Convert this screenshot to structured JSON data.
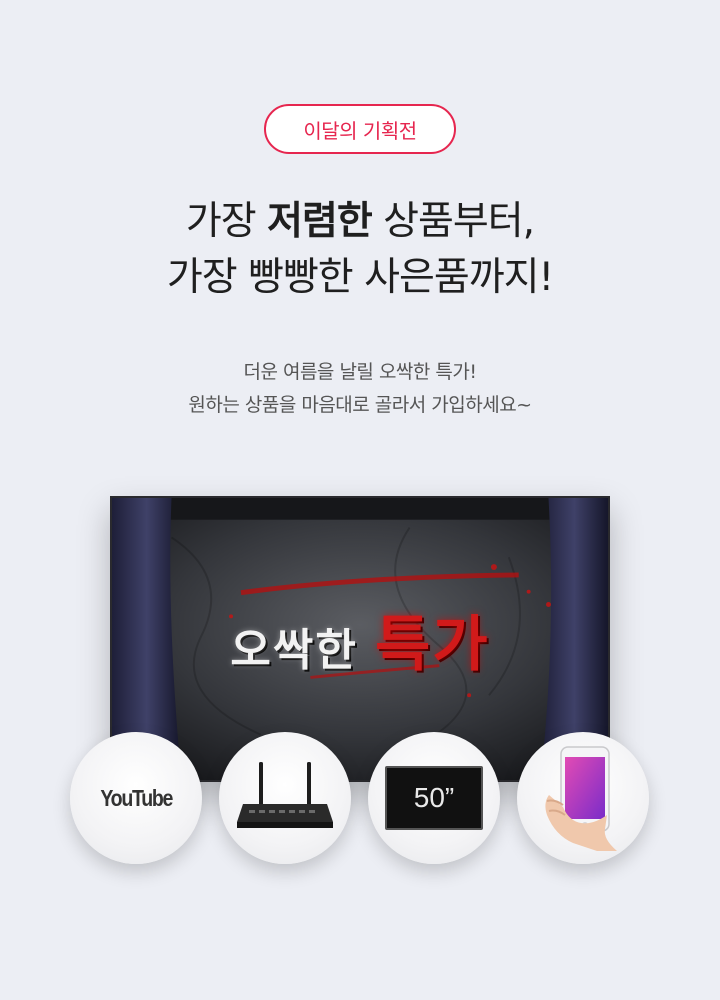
{
  "badge": {
    "label": "이달의 기획전",
    "color": "#e6264f"
  },
  "headline": {
    "line1_pre": "가장 ",
    "line1_bold": "저렴한",
    "line1_post": " 상품부터,",
    "line2": "가장 빵빵한 사은품까지!"
  },
  "subtitle": {
    "line1": "더운 여름을 날릴 오싹한 특가!",
    "line2": "원하는 상품을 마음대로 골라서 가입하세요~"
  },
  "tv": {
    "title_white": "오싹한 ",
    "title_red": "특가"
  },
  "gifts": {
    "youtube_label": "YouTube",
    "router_icon": "router-icon",
    "monitor_label": "50”",
    "phone_icon": "smartphone-in-hand-icon"
  },
  "colors": {
    "accent": "#e6264f",
    "background": "#eceef4"
  }
}
